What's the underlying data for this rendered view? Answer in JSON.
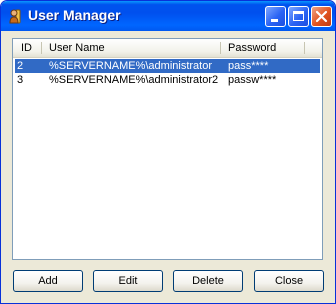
{
  "window": {
    "title": "User Manager"
  },
  "list": {
    "columns": [
      "ID",
      "User Name",
      "Password"
    ],
    "rows": [
      {
        "id": "2",
        "user": "%SERVERNAME%\\administrator",
        "password": "pass****",
        "selected": true
      },
      {
        "id": "3",
        "user": "%SERVERNAME%\\administrator2",
        "password": "passw****",
        "selected": false
      }
    ]
  },
  "buttons": {
    "add": "Add",
    "edit": "Edit",
    "delete": "Delete",
    "close": "Close"
  },
  "colors": {
    "titlebar": "#0054e3",
    "selection": "#316ac5",
    "close_button": "#e0521f"
  },
  "icons": {
    "app": "user-manager-app-icon",
    "minimize": "minimize-icon",
    "maximize": "maximize-icon",
    "close": "close-icon"
  }
}
